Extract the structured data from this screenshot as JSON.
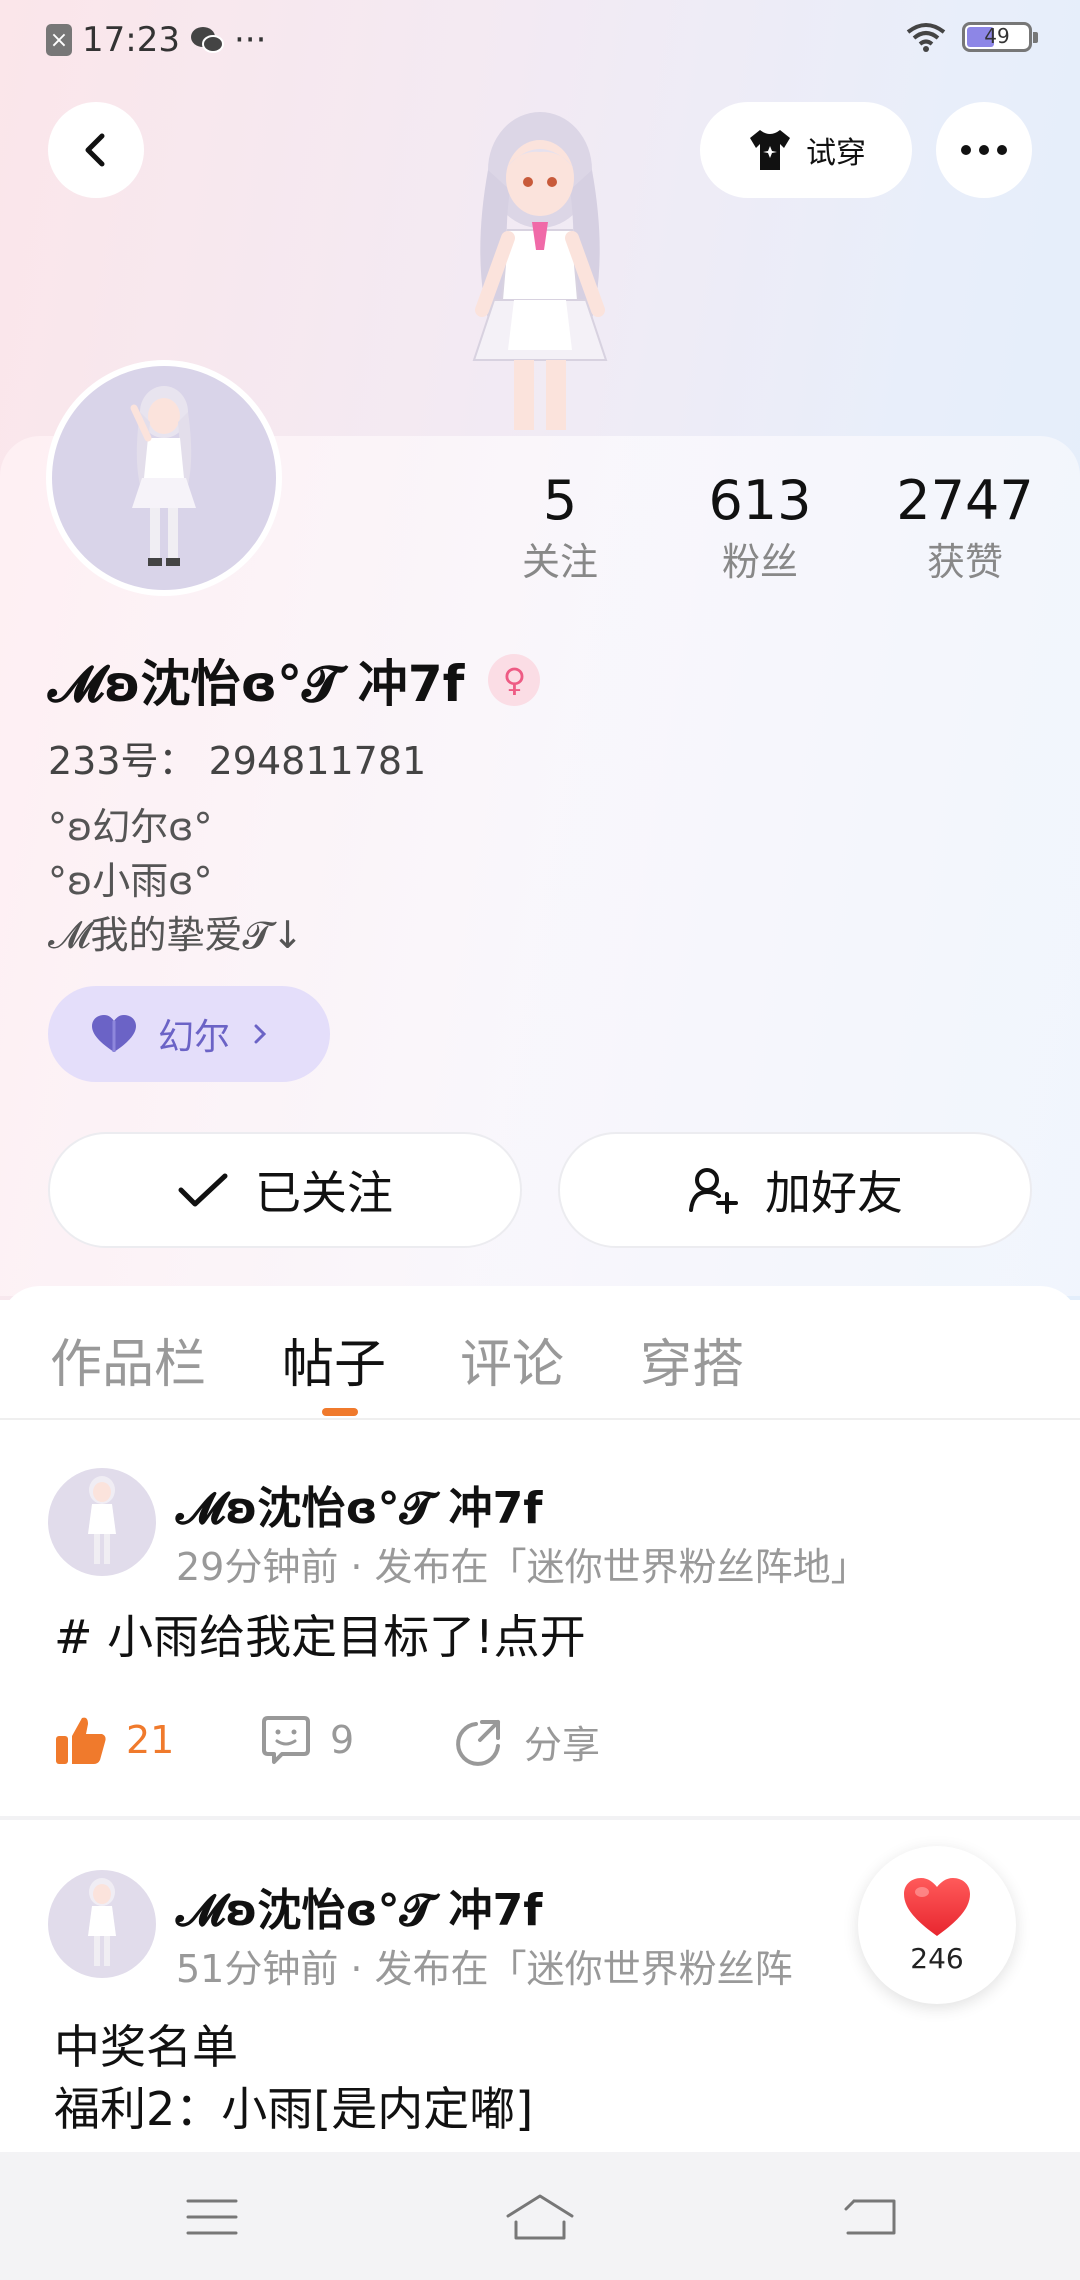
{
  "status_bar": {
    "time": "17:23",
    "extra": "···",
    "battery": "49",
    "battery_level": 0.49
  },
  "header": {
    "tryon_label": "试穿"
  },
  "profile": {
    "stats": [
      {
        "value": "5",
        "label": "关注"
      },
      {
        "value": "613",
        "label": "粉丝"
      },
      {
        "value": "2747",
        "label": "获赞"
      }
    ],
    "username": "𝓜ʚ沈怡ɞ°𝓣 冲7f",
    "uid_label": "233号：",
    "uid": "294811781",
    "bio": [
      "°ʚ幻尔ɞ°",
      "°ʚ小雨ɞ°",
      "𝓜我的挚爱𝓣↓"
    ],
    "friend_tag": "幻尔",
    "follow_label": "已关注",
    "add_friend_label": "加好友"
  },
  "tabs": [
    {
      "label": "作品栏",
      "active": false
    },
    {
      "label": "帖子",
      "active": true
    },
    {
      "label": "评论",
      "active": false
    },
    {
      "label": "穿搭",
      "active": false
    }
  ],
  "posts": [
    {
      "author": "𝓜ʚ沈怡ɞ°𝓣 冲7f",
      "meta": "29分钟前 · 发布在「迷你世界粉丝阵地」",
      "text_lines": [
        "# 小雨给我定目标了!点开"
      ],
      "likes": "21",
      "comments": "9",
      "share_label": "分享"
    },
    {
      "author": "𝓜ʚ沈怡ɞ°𝓣 冲7f",
      "meta": "51分钟前 · 发布在「迷你世界粉丝阵",
      "text_lines": [
        "中奖名单",
        "福利2：小雨[是内定嘟]"
      ]
    }
  ],
  "float_like": {
    "count": "246"
  },
  "colors": {
    "accent_orange": "#f07a2c",
    "friend_purple": "#6b63c6",
    "gender_pink": "#ee5b84"
  }
}
